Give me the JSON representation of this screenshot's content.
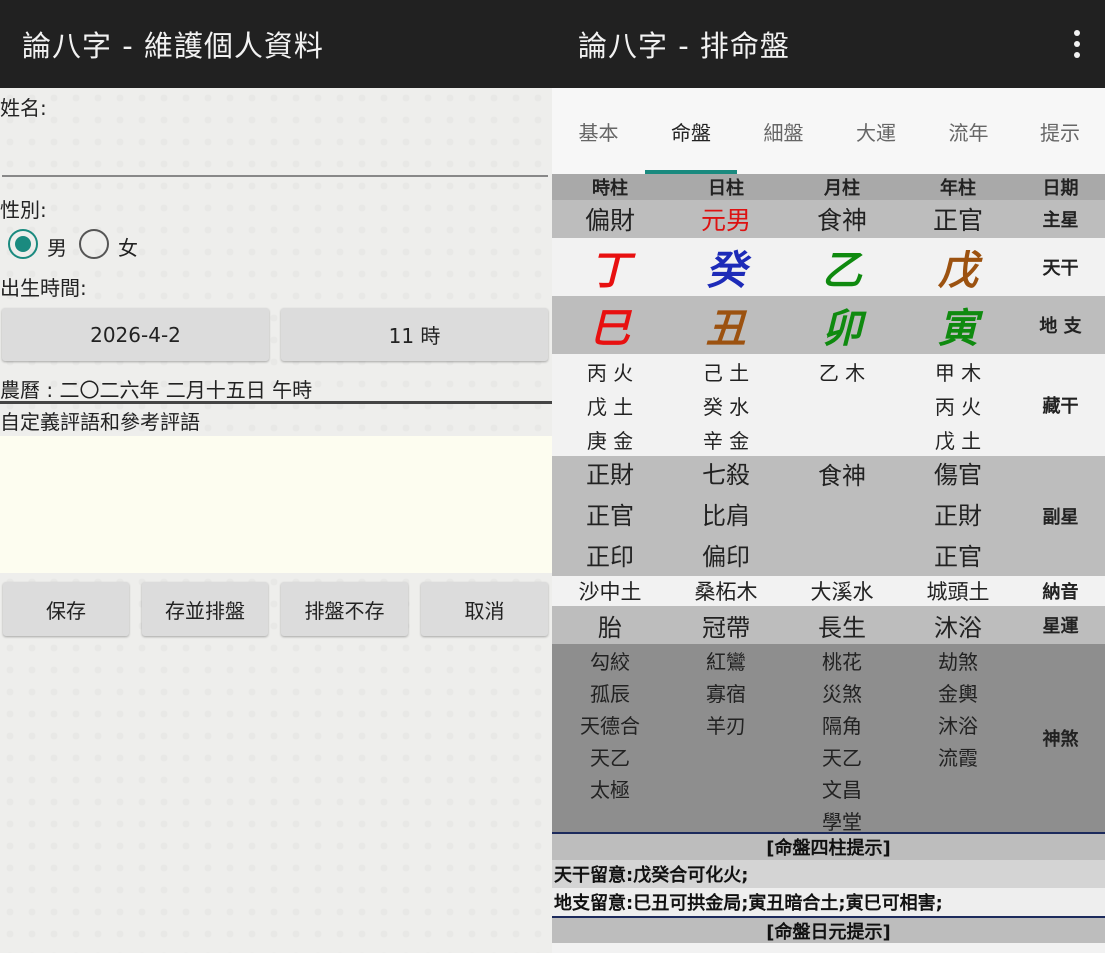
{
  "left": {
    "title": "論八字 - 維護個人資料",
    "name_label": "姓名:",
    "gender_label": "性別:",
    "gender_options": [
      {
        "label": "男",
        "checked": true
      },
      {
        "label": "女",
        "checked": false
      }
    ],
    "birth_label": "出生時間:",
    "date_value": "2026-4-2",
    "hour_value": "11 時",
    "lunar": "農曆 : 二〇二六年 二月十五日 午時",
    "comment_label": "自定義評語和參考評語",
    "buttons": [
      "保存",
      "存並排盤",
      "排盤不存",
      "取消"
    ]
  },
  "right": {
    "title": "論八字 - 排命盤",
    "tabs": [
      "基本",
      "命盤",
      "細盤",
      "大運",
      "流年",
      "提示"
    ],
    "active_tab": "命盤",
    "header": [
      "時柱",
      "日柱",
      "月柱",
      "年柱",
      "日期"
    ],
    "main_star": {
      "values": [
        "偏財",
        "元男",
        "食神",
        "正官"
      ],
      "label": "主星",
      "colors": [
        "#222222",
        "#dd1111",
        "#222222",
        "#222222"
      ]
    },
    "stems": {
      "values": [
        "丁",
        "癸",
        "乙",
        "戊"
      ],
      "label": "天干",
      "colors": [
        "#e81010",
        "#1d2bb8",
        "#0f8a0f",
        "#9c5210"
      ]
    },
    "branches": {
      "values": [
        "巳",
        "丑",
        "卯",
        "寅"
      ],
      "label": "地 支",
      "colors": [
        "#e81010",
        "#9c5210",
        "#0f8a0f",
        "#0f8a0f"
      ]
    },
    "hidden_stems": {
      "label": "藏干",
      "columns": [
        [
          "丙 火",
          "戊 土",
          "庚 金"
        ],
        [
          "己 土",
          "癸 水",
          "辛 金"
        ],
        [
          "乙 木"
        ],
        [
          "甲 木",
          "丙 火",
          "戊 土"
        ]
      ]
    },
    "sub_stars": {
      "label": "副星",
      "columns": [
        [
          "正財",
          "正官",
          "正印"
        ],
        [
          "七殺",
          "比肩",
          "偏印"
        ],
        [
          "食神"
        ],
        [
          "傷官",
          "正財",
          "正官"
        ]
      ]
    },
    "nayin": {
      "values": [
        "沙中土",
        "桑柘木",
        "大溪水",
        "城頭土"
      ],
      "label": "納音"
    },
    "star_fortune": {
      "values": [
        "胎",
        "冠帶",
        "長生",
        "沐浴"
      ],
      "label": "星運"
    },
    "shensha": {
      "label": "神煞",
      "columns": [
        [
          "勾絞",
          "孤辰",
          "天德合",
          "天乙",
          "太極"
        ],
        [
          "紅鸞",
          "寡宿",
          "羊刃"
        ],
        [
          "桃花",
          "災煞",
          "隔角",
          "天乙",
          "文昌",
          "學堂"
        ],
        [
          "劫煞",
          "金輿",
          "沐浴",
          "流霞"
        ]
      ]
    },
    "hint_title_1": "[命盤四柱提示]",
    "hint_stem": "天干留意:戊癸合可化火;",
    "hint_branch": "地支留意:巳丑可拱金局;寅丑暗合土;寅巳可相害;",
    "hint_title_2": "[命盤日元提示]"
  }
}
